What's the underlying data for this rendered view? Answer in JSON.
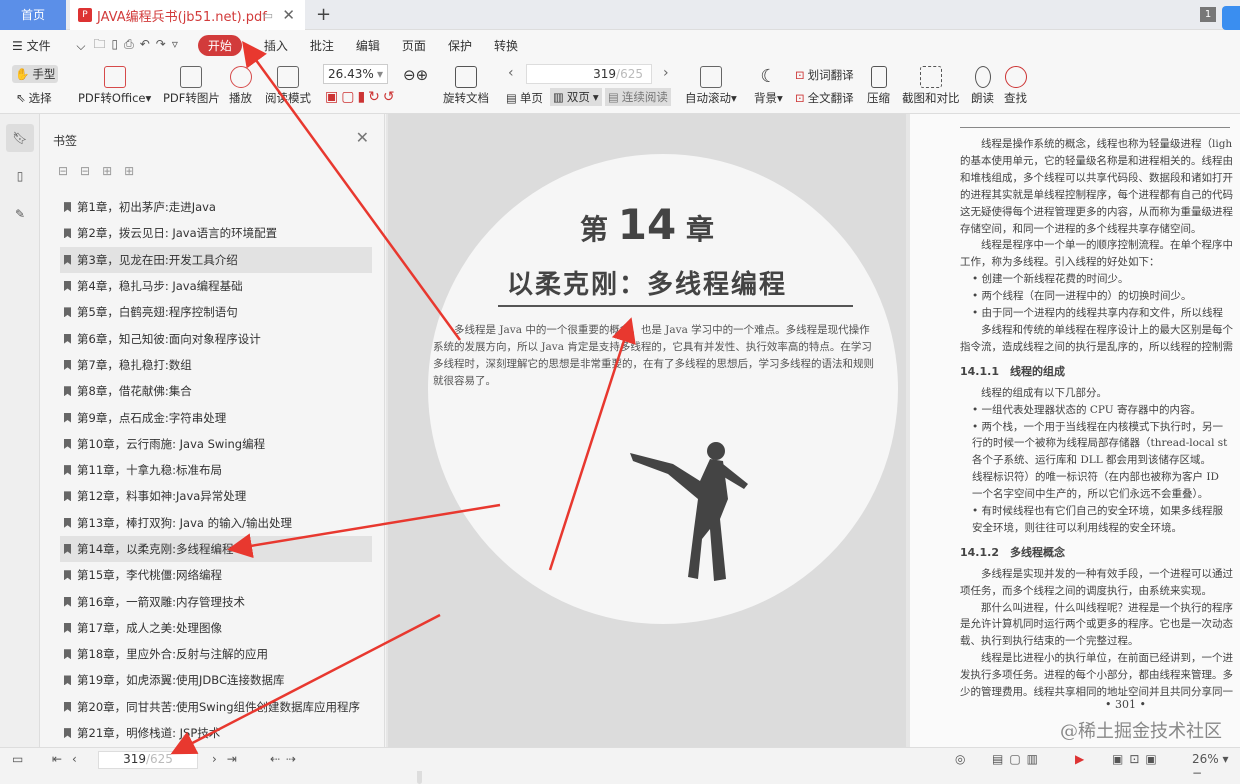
{
  "tabs": {
    "home": "首页",
    "document": "JAVA编程兵书(jb51.net).pdf",
    "notif_count": "1"
  },
  "menu": {
    "file": "文件",
    "items": [
      "开始",
      "插入",
      "批注",
      "编辑",
      "页面",
      "保护",
      "转换"
    ]
  },
  "toolbar": {
    "hand": "手型",
    "select": "选择",
    "pdf_to_office": "PDF转Office",
    "pdf_to_image": "PDF转图片",
    "play": "播放",
    "read_mode": "阅读模式",
    "zoom": "26.43%",
    "rotate_doc": "旋转文档",
    "page_current": "319",
    "page_total": "/625",
    "single": "单页",
    "double": "双页",
    "continuous": "连续阅读",
    "auto_scroll": "自动滚动",
    "background": "背景",
    "word_translate": "划词翻译",
    "full_translate": "全文翻译",
    "compress": "压缩",
    "screenshot_compare": "截图和对比",
    "read_aloud": "朗读",
    "find": "查找"
  },
  "bookmarks": {
    "title": "书签",
    "items": [
      "第1章，初出茅庐:走进Java",
      "第2章，拨云见日: Java语言的环境配置",
      "第3章，见龙在田:开发工具介绍",
      "第4章，稳扎马步: Java编程基础",
      "第5章，白鹤亮翅:程序控制语句",
      "第6章，知己知彼:面向对象程序设计",
      "第7章，稳扎稳打:数组",
      "第8章，借花献佛:集合",
      "第9章，点石成金:字符串处理",
      "第10章，云行雨施: Java Swing编程",
      "第11章，十拿九稳:标准布局",
      "第12章，料事如神:Java异常处理",
      "第13章，棒打双狗: Java 的输入/输出处理",
      "第14章，以柔克刚:多线程编程",
      "第15章，李代桃僵:网络编程",
      "第16章，一箭双雕:内存管理技术",
      "第17章，成人之美:处理图像",
      "第18章，里应外合:反射与注解的应用",
      "第19章，如虎添翼:使用JDBC连接数据库",
      "第20章，同甘共苦:使用Swing组件创建数据库应用程序",
      "第21章，明修栈道: JSP技术"
    ]
  },
  "left_page": {
    "chapter_prefix": "第",
    "chapter_num": "14",
    "chapter_suffix": "章",
    "title": "以柔克刚：多线程编程",
    "intro": "多线程是 Java 中的一个很重要的概念，也是 Java 学习中的一个难点。多线程是现代操作系统的发展方向，所以 Java 肯定是支持多线程的，它具有并发性、执行效率高的特点。在学习多线程时，深刻理解它的思想是非常重要的，在有了多线程的思想后，学习多线程的语法和规则就很容易了。"
  },
  "right_page": {
    "p1": [
      "线程是操作系统的概念，线程也称为轻量级进程（ligh",
      "的基本使用单元，它的轻量级名称是和进程相关的。线程由",
      "和堆栈组成，多个线程可以共享代码段、数据段和诸如打开",
      "的进程其实就是单线程控制程序，每个进程都有自己的代码",
      "这无疑使得每个进程管理更多的内容，从而称为重量级进程",
      "存储空间，和同一个进程的多个线程共享存储空间。"
    ],
    "p2": [
      "线程是程序中一个单一的顺序控制流程。在单个程序中",
      "工作，称为多线程。引入线程的好处如下："
    ],
    "bullets1": [
      "• 创建一个新线程花费的时间少。",
      "• 两个线程（在同一进程中的）的切换时间少。",
      "• 由于同一个进程内的线程共享内存和文件，所以线程"
    ],
    "p3": [
      "多线程和传统的单线程在程序设计上的最大区别是每个",
      "指令流，造成线程之间的执行是乱序的，所以线程的控制需"
    ],
    "h1": "14.1.1　线程的组成",
    "p4": [
      "线程的组成有以下几部分。"
    ],
    "bullets2": [
      "• 一组代表处理器状态的 CPU 寄存器中的内容。",
      "• 两个栈，一个用于当线程在内核模式下执行时，另一",
      "  行的时候一个被称为线程局部存储器（thread-local st",
      "  各个子系统、运行库和 DLL 都会用到该储存区域。",
      "  线程标识符）的唯一标识符（在内部也被称为客户 ID",
      "  一个名字空间中生产的，所以它们永远不会重叠）。",
      "• 有时候线程也有它们自己的安全环境，如果多线程服",
      "  安全环境，则往往可以利用线程的安全环境。"
    ],
    "h2": "14.1.2　多线程概念",
    "p5": [
      "多线程是实现并发的一种有效手段，一个进程可以通过",
      "项任务，而多个线程之间的调度执行，由系统来实现。",
      "　　那什么叫进程，什么叫线程呢？进程是一个执行的程序",
      "是允许计算机同时运行两个或更多的程序。它也是一次动态",
      "载、执行到执行结束的一个完整过程。",
      "　　线程是比进程小的执行单位，在前面已经讲到，一个进",
      "发执行多项任务。进程的每个小部分，都由线程来管理。多",
      "少的管理费用。线程共享相同的地址空间并且共同分享同一"
    ],
    "page_number": "• 301 •"
  },
  "watermark": "@稀土掘金技术社区",
  "status": {
    "page_current": "319",
    "page_total": "/625",
    "zoom": "26%"
  },
  "colors": {
    "accent": "#d23b3b",
    "home_tab": "#5b8fe8",
    "arrow": "#e8382f"
  }
}
